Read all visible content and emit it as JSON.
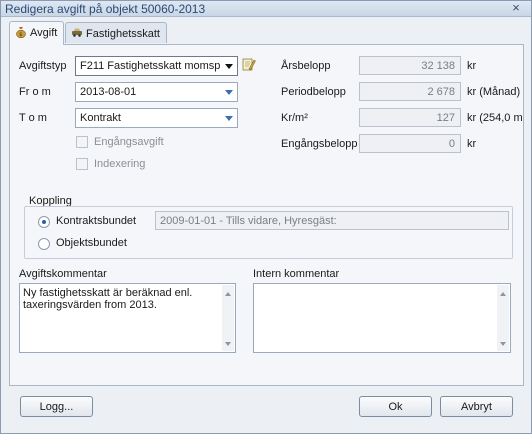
{
  "window": {
    "title": "Redigera avgift på objekt 50060-2013",
    "close_glyph": "×"
  },
  "tabs": [
    {
      "label": "Avgift",
      "icon": "money-bag-icon",
      "active": true
    },
    {
      "label": "Fastighetsskatt",
      "icon": "car-icon",
      "active": false
    }
  ],
  "form": {
    "avgiftstyp_label": "Avgiftstyp",
    "avgiftstyp_value": "F211   Fastighetsskatt momsp",
    "from_label": "Fr o m",
    "from_value": "2013-08-01",
    "tom_label": "T o m",
    "tom_value": "Kontrakt",
    "engangsavgift_label": "Engångsavgift",
    "indexering_label": "Indexering"
  },
  "amounts": {
    "arsbelopp_label": "Årsbelopp",
    "arsbelopp_value": "32 138",
    "arsbelopp_unit": "kr",
    "periodbelopp_label": "Periodbelopp",
    "periodbelopp_value": "2 678",
    "periodbelopp_unit": "kr  (Månad)",
    "krm2_label": "Kr/m²",
    "krm2_value": "127",
    "krm2_unit": "kr  (254,0 m",
    "engangsbelopp_label": "Engångsbelopp",
    "engangsbelopp_value": "0",
    "engangsbelopp_unit": "kr"
  },
  "koppling": {
    "legend": "Koppling",
    "kontraktsbundet_label": "Kontraktsbundet",
    "objektsbundet_label": "Objektsbundet",
    "kontrakt_text": "2009-01-01 - Tills vidare, Hyresgäst:"
  },
  "comments": {
    "avgift_label": "Avgiftskommentar",
    "avgift_text": "Ny fastighetsskatt är beräknad enl. taxeringsvärden from 2013.",
    "intern_label": "Intern kommentar",
    "intern_text": ""
  },
  "buttons": {
    "logg": "Logg...",
    "ok": "Ok",
    "avbryt": "Avbryt"
  },
  "colors": {
    "title_text": "#2c4a72",
    "accent": "#3a6fb0"
  }
}
